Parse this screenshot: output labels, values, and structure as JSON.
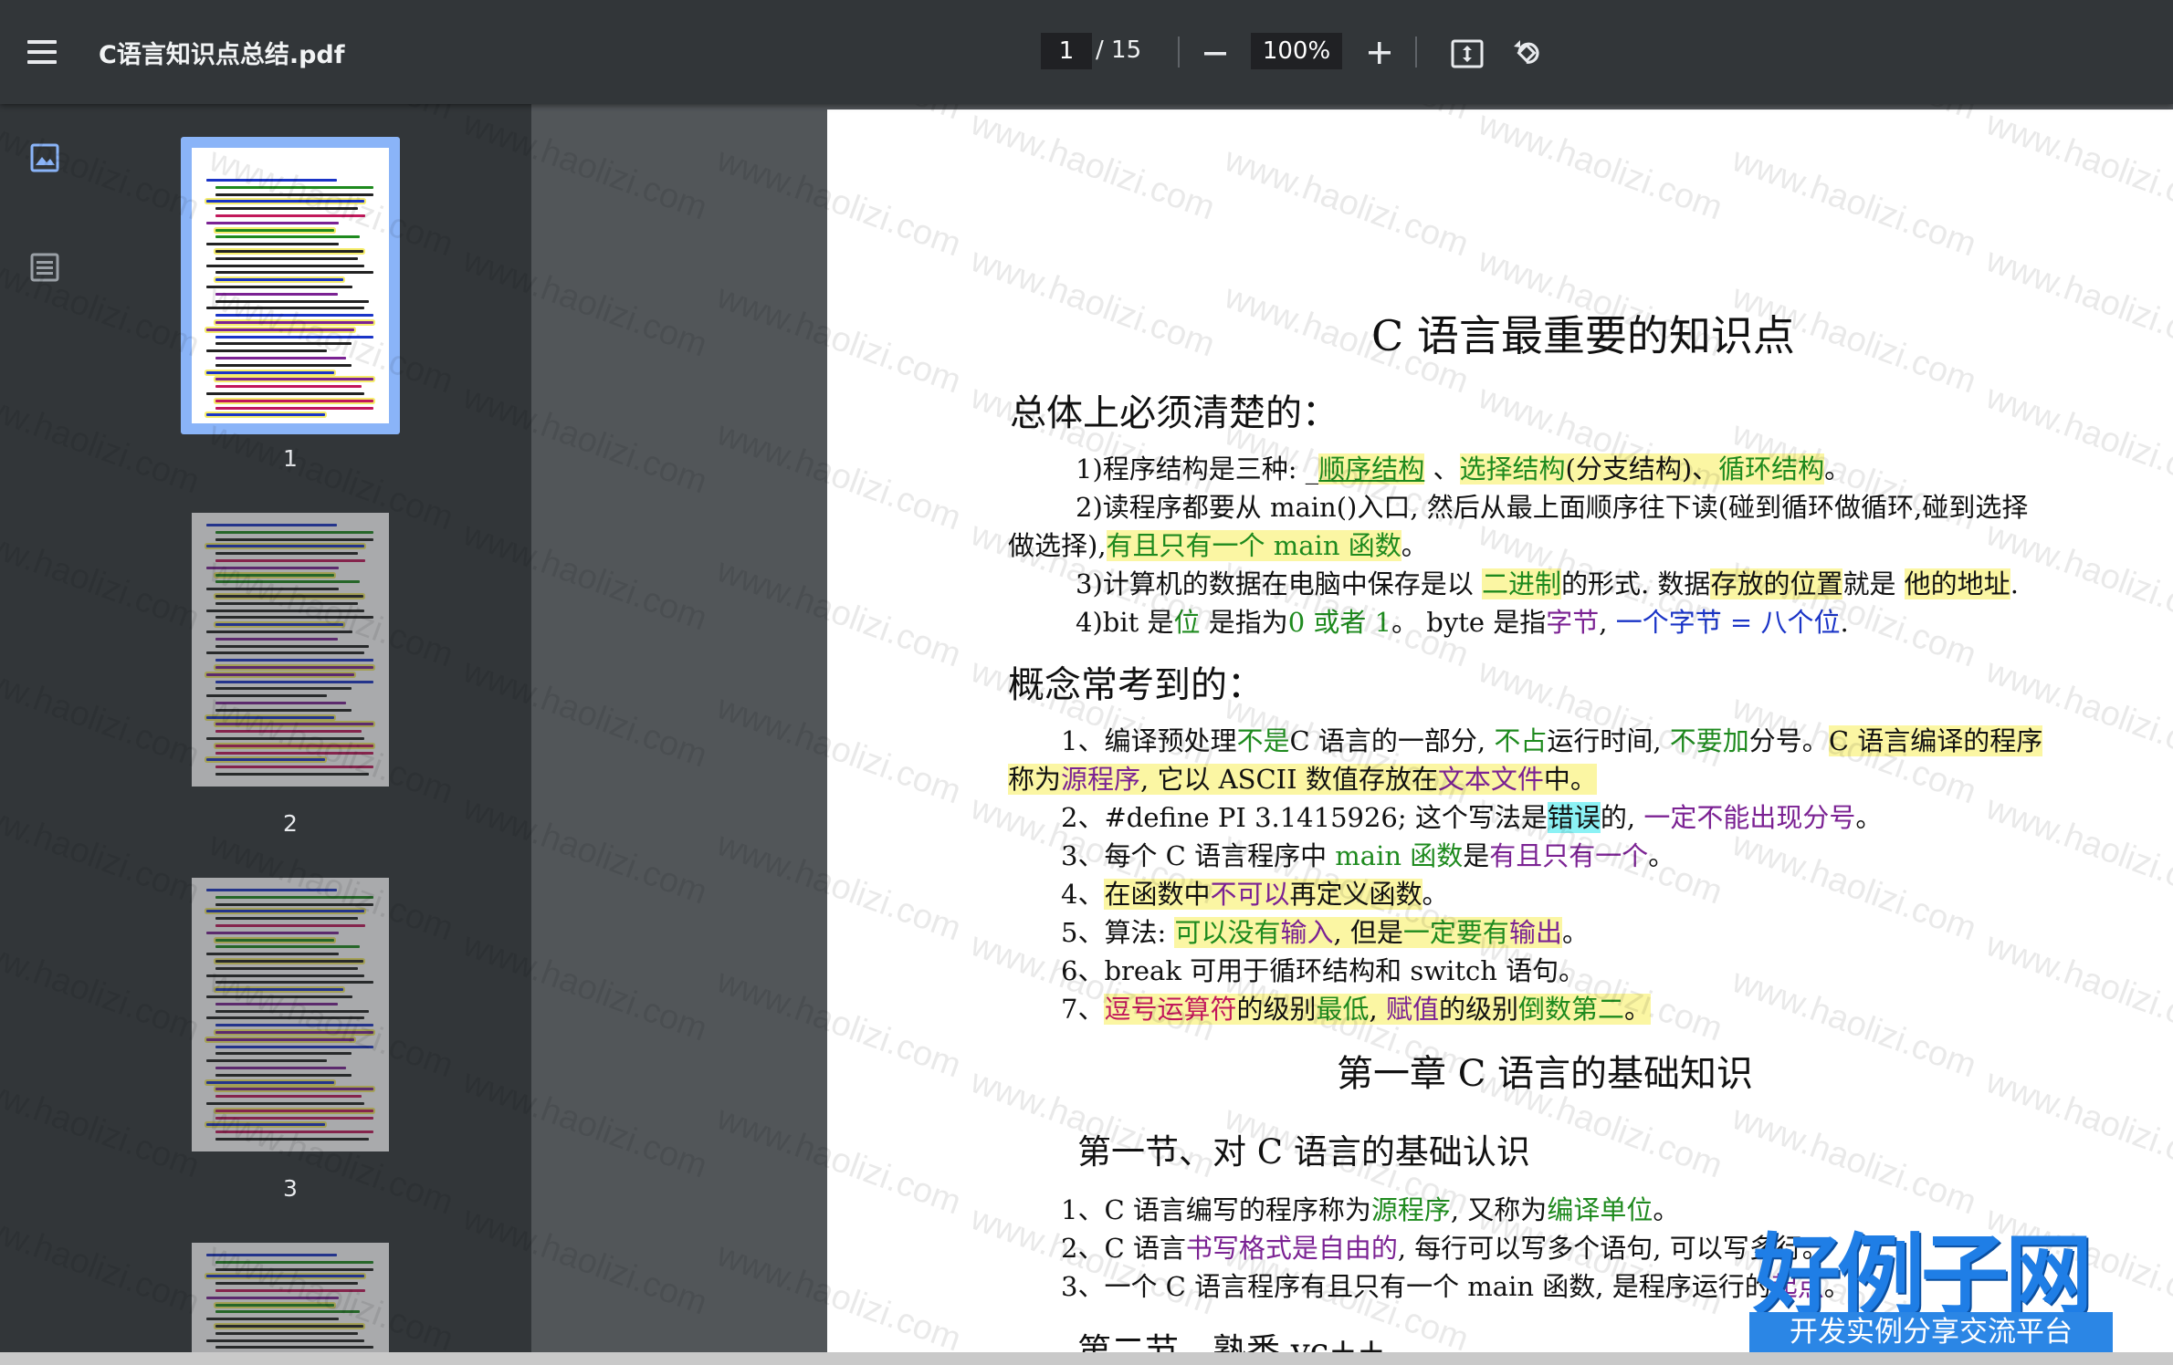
{
  "toolbar": {
    "file_name": "C语言知识点总结.pdf",
    "page_current": "1",
    "page_total": "/ 15",
    "zoom": "100%",
    "icons": [
      "menu-icon",
      "zoom-out-icon",
      "zoom-in-icon",
      "fit-page-icon",
      "rotate-icon"
    ]
  },
  "sidebar": {
    "icons": [
      "thumbnail-view-icon",
      "outline-view-icon"
    ],
    "thumbnails": [
      "1",
      "2",
      "3"
    ]
  },
  "watermark": "www.haolizi.com",
  "document": {
    "title": "C 语言最重要的知识点",
    "section1": {
      "heading": "总体上必须清楚的：",
      "lines": [
        [
          "1)程序结构是三种: _",
          "顺序结构",
          " 、",
          "选择结构",
          "(分支结构)、",
          "循环结构",
          "。"
        ],
        [
          "2)读程序都要从 main()入口, 然后从最上面顺序往下读(碰到循环做循环,碰到选择"
        ],
        [
          "做选择),",
          "有且只有一个 main 函数",
          "。"
        ],
        [
          "3)计算机的数据在电脑中保存是以 ",
          "二进制",
          "的形式. 数据",
          "存放的位置",
          "就是 ",
          "他的地址",
          "."
        ],
        [
          "4)bit 是",
          "位",
          " 是指为",
          "0 或者 1",
          "。 byte 是指",
          "字节",
          ", ",
          "一个字节 = 八个位",
          "."
        ]
      ]
    },
    "section2": {
      "heading": "概念常考到的：",
      "lines": [
        [
          "1、编译预处理",
          "不是",
          "C 语言的一部分, ",
          "不占",
          "运行时间, ",
          "不要加",
          "分号。",
          "C 语言编译的程序"
        ],
        [
          "称为",
          "源程序",
          ", 它以 ASCII 数值",
          "存放在",
          "文本文件",
          "中。"
        ],
        [
          "2、#define PI 3.1415926; 这个写法是",
          "错误",
          "的, ",
          "一定不能出现分号",
          "。"
        ],
        [
          "3、每个 C 语言程序中 ",
          "main 函数",
          "是",
          "有且只有一个",
          "。"
        ],
        [
          "4、",
          "在函数中",
          "不可以",
          "再定义函数",
          "。"
        ],
        [
          "5、算法: ",
          "可以没有",
          "输入",
          ", 但是",
          "一定要有",
          "输出",
          "。"
        ],
        [
          "6、break 可用于循环结构和 switch 语句。"
        ],
        [
          "7、",
          "逗号运算符",
          "的级别",
          "最低",
          ", ",
          "赋值",
          "的级别",
          "倒数第二",
          "。"
        ]
      ]
    },
    "chapter1": "第一章 C 语言的基础知识",
    "section_1_1": "第一节、对 C 语言的基础认识",
    "ch1_lines": [
      [
        "1、C 语言编写的程序称为",
        "源程序",
        ", 又称为",
        "编译单位",
        "。"
      ],
      [
        "2、C 语言",
        "书写格式是自由的",
        ", 每行可以写多个语句, 可以写多行。"
      ],
      [
        "3、一个 C 语言程序有且只有一个 main 函数, 是程序运行的",
        "起点",
        "。"
      ]
    ],
    "section_1_2": "第二节、熟悉 vc++"
  },
  "logo": {
    "title": "好例子网",
    "subtitle": "开发实例分享交流平台"
  }
}
